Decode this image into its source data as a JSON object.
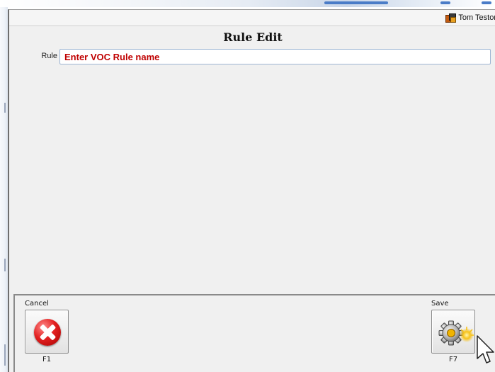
{
  "header": {
    "user_name": "Tom Testor"
  },
  "page": {
    "title": "Rule Edit"
  },
  "form": {
    "rule_label": "Rule",
    "rule_placeholder": "Enter VOC Rule name",
    "rule_value": ""
  },
  "toolbar": {
    "cancel": {
      "label": "Cancel",
      "key": "F1"
    },
    "save": {
      "label": "Save",
      "key": "F7"
    }
  },
  "colors": {
    "placeholder_text": "#c00000",
    "window_bg": "#f0f0f0",
    "input_border": "#9db5d3",
    "cancel_icon": "#e32121",
    "save_highlight": "#f7c21a"
  },
  "icons": {
    "user": "user-avatar-icon",
    "cancel": "cancel-x-icon",
    "save": "gear-save-icon",
    "cursor": "mouse-pointer-icon"
  }
}
